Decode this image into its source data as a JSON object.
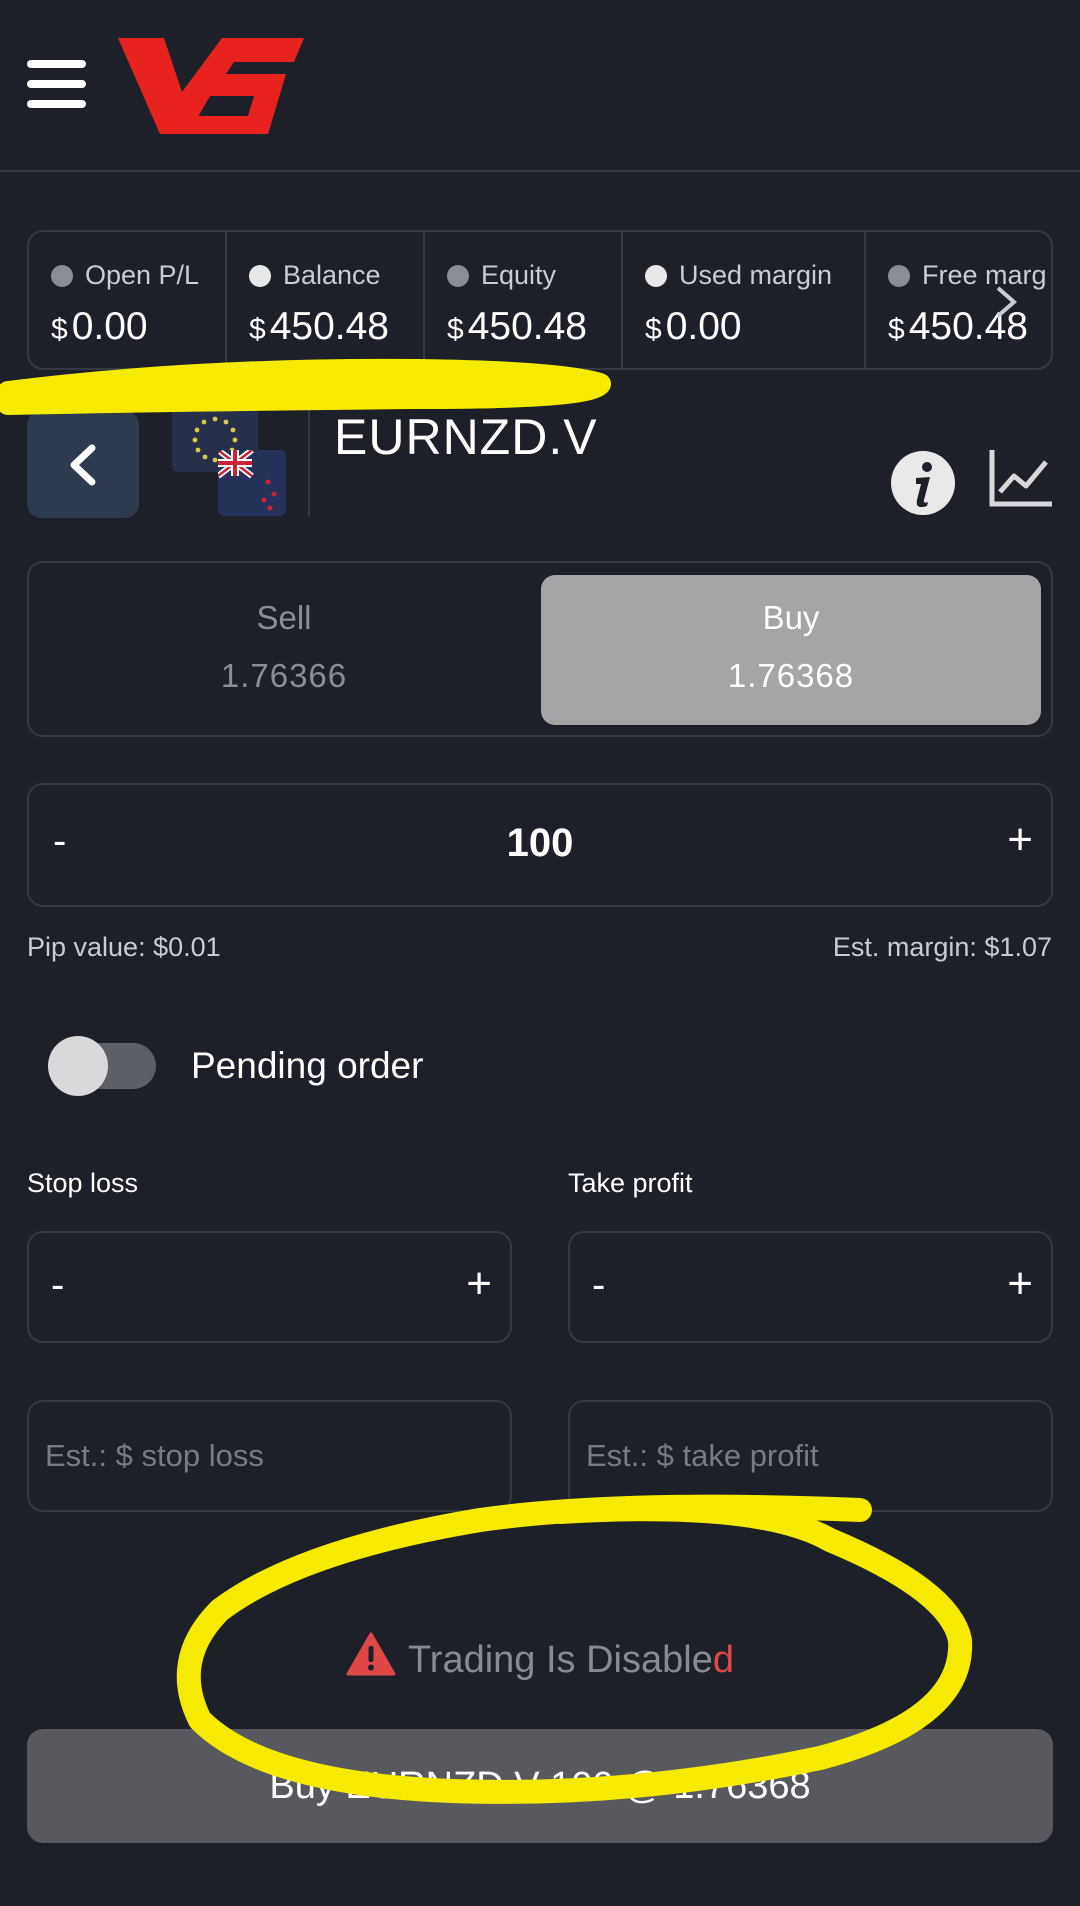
{
  "account": {
    "items": [
      {
        "label": "Open P/L",
        "currency": "$",
        "value": "0.00",
        "dot": "gray"
      },
      {
        "label": "Balance",
        "currency": "$",
        "value": "450.48",
        "dot": "white"
      },
      {
        "label": "Equity",
        "currency": "$",
        "value": "450.48",
        "dot": "gray"
      },
      {
        "label": "Used margin",
        "currency": "$",
        "value": "0.00",
        "dot": "white"
      },
      {
        "label": "Free marg",
        "currency": "$",
        "value": "450.48",
        "dot": "gray"
      }
    ],
    "more_icon": "chevron-right-icon"
  },
  "instrument": {
    "symbol": "EURNZD.V",
    "info_icon": "info-icon",
    "chart_icon": "chart-icon"
  },
  "trade": {
    "sell_label": "Sell",
    "sell_price": "1.76366",
    "buy_label": "Buy",
    "buy_price": "1.76368",
    "selected_side": "Buy",
    "quantity": "100",
    "minus": "-",
    "plus": "+",
    "pip_value": "Pip value: $0.01",
    "est_margin": "Est. margin: $1.07"
  },
  "pending": {
    "label": "Pending order",
    "enabled": false
  },
  "stop_loss": {
    "label": "Stop loss",
    "placeholder": "Est.: $ stop loss"
  },
  "take_profit": {
    "label": "Take profit",
    "placeholder": "Est.: $ take profit"
  },
  "notice": {
    "text_main": "Trading Is Disable",
    "text_end": "d",
    "icon": "warning-icon"
  },
  "submit": {
    "label": "Buy EURNZD.V 100 @ 1.76368"
  },
  "colors": {
    "background": "#1d2028",
    "border": "#353944",
    "logo_red": "#e8231f",
    "buy_active": "#a5a5a7",
    "warning_red": "#e04848",
    "highlighter": "#f5ea00"
  }
}
